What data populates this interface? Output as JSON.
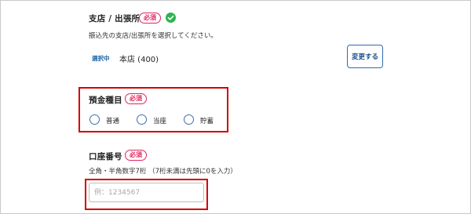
{
  "branch_section": {
    "title": "支店 / 出張所",
    "required_badge": "必須",
    "description": "振込先の支店/出張所を選択してください。",
    "selected_badge": "選択中",
    "selected_value": "本店 (400)",
    "change_button": "変更する"
  },
  "deposit_type": {
    "title": "預金種目",
    "required_badge": "必須",
    "options": [
      "普通",
      "当座",
      "貯蓄"
    ]
  },
  "account_number": {
    "title": "口座番号",
    "required_badge": "必須",
    "description": "全角・半角数字7桁 （7桁未満は先頭に0を入力）",
    "placeholder": "例：1234567",
    "value": ""
  },
  "colors": {
    "required": "#e0245e",
    "highlight_box": "#d40000",
    "accent_blue": "#2f6bb3",
    "check_green": "#2eb350"
  }
}
